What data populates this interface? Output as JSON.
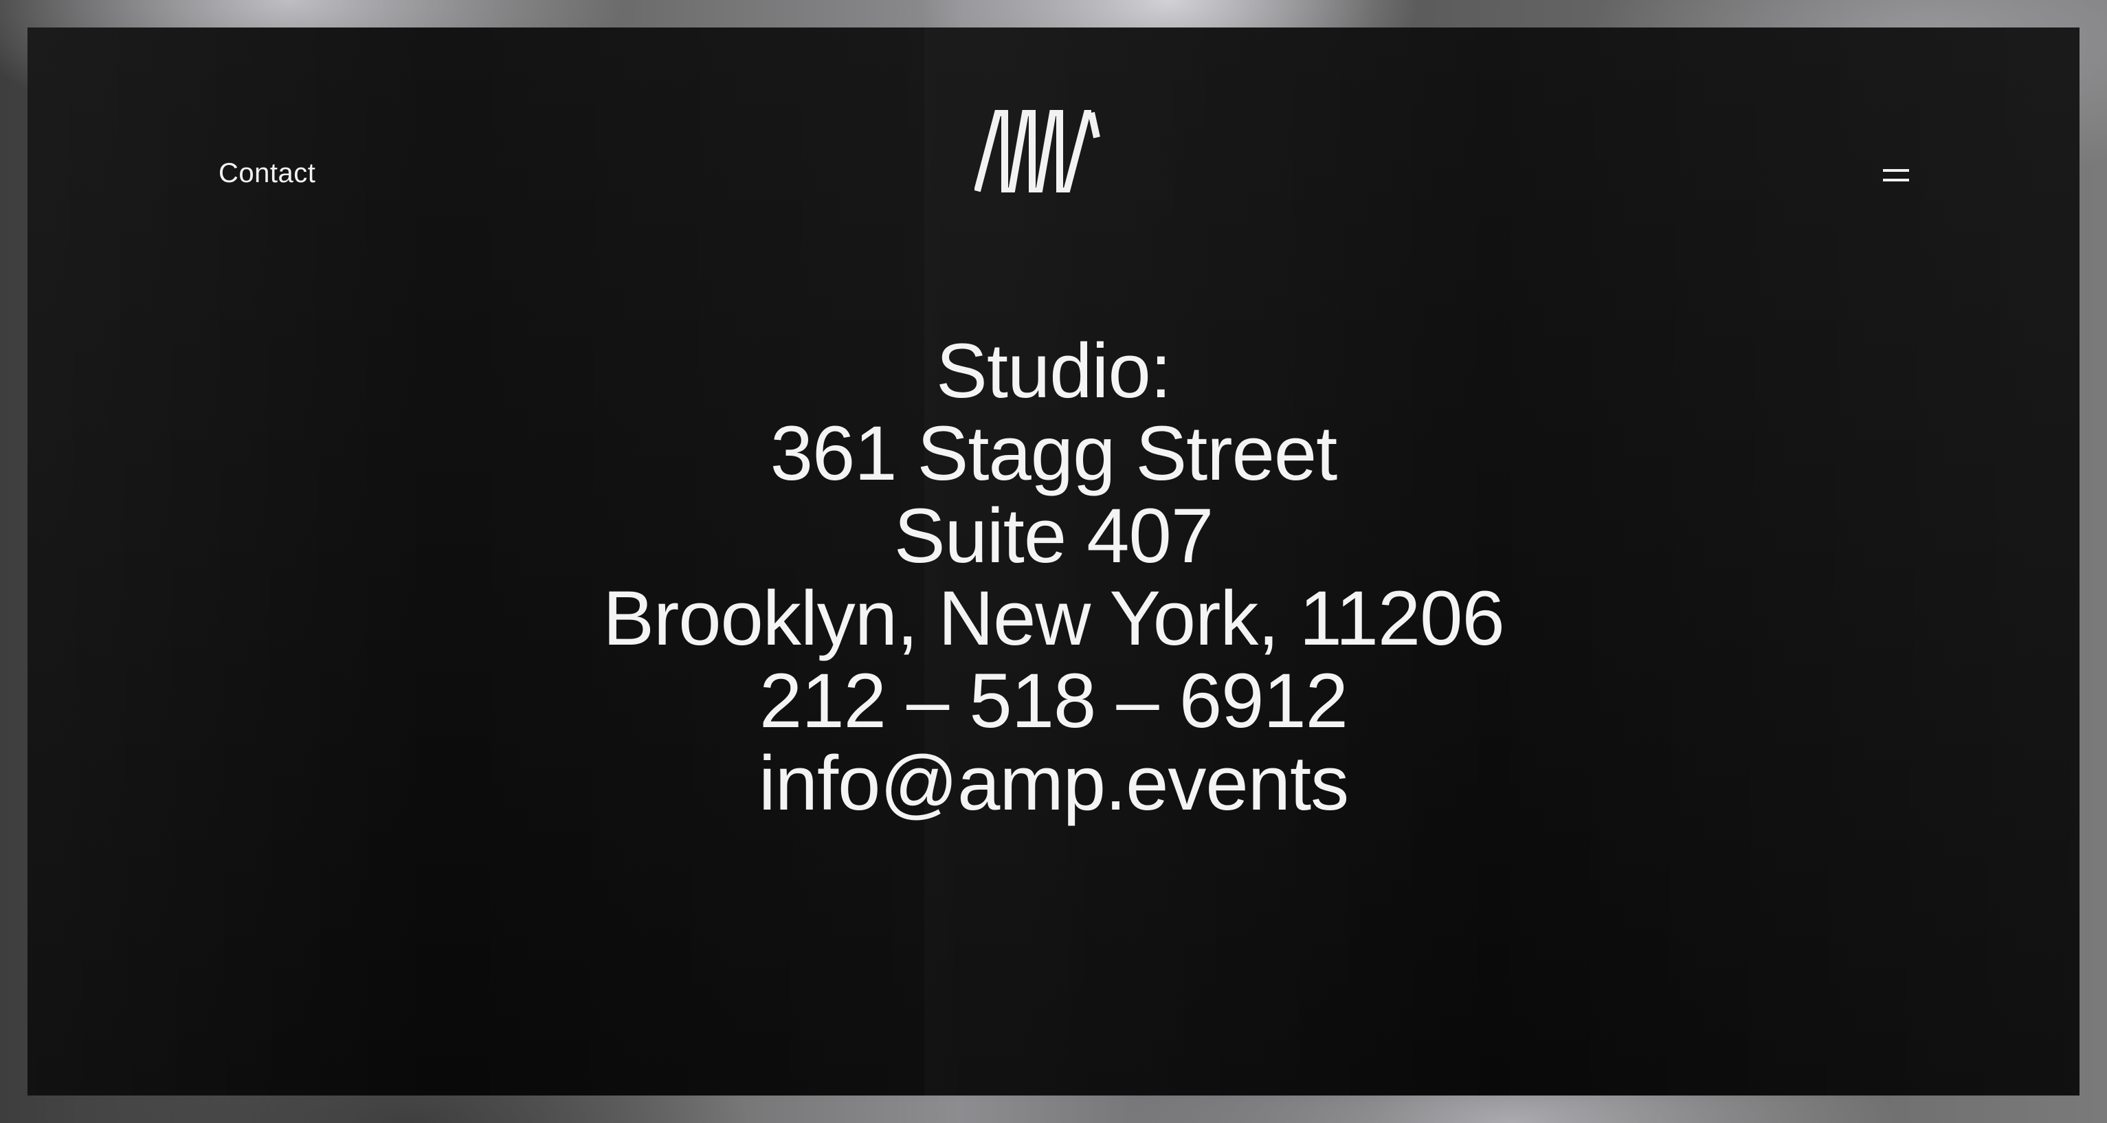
{
  "nav": {
    "contact_label": "Contact",
    "logo_icon": "amp-logo-icon",
    "menu_icon": "hamburger-menu-icon"
  },
  "address": {
    "label": "Studio:",
    "street": "361 Stagg Street",
    "suite": "Suite 407",
    "city": "Brooklyn, New York, 11206",
    "phone": "212 – 518 – 6912",
    "email": "info@amp.events"
  },
  "colors": {
    "panel_background": "#0f0f0f",
    "text": "#f4f4f4"
  }
}
